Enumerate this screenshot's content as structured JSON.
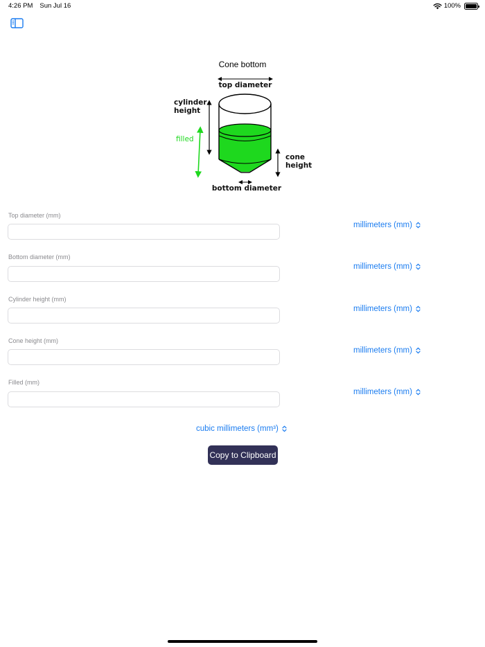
{
  "status_bar": {
    "time": "4:26 PM",
    "date": "Sun Jul 16",
    "battery": "100%"
  },
  "toolbar": {
    "sidebar_icon": "sidebar-toggle-icon"
  },
  "page": {
    "title": "Cone bottom"
  },
  "diagram": {
    "top_diameter": "top diameter",
    "cylinder_height_1": "cylinder",
    "cylinder_height_2": "height",
    "filled": "filled",
    "cone_height_1": "cone",
    "cone_height_2": "height",
    "bottom_diameter": "bottom diameter",
    "fill_color": "#1ed81e"
  },
  "fields": [
    {
      "label": "Top diameter (mm)",
      "value": "",
      "placeholder": "",
      "unit": "millimeters (mm)"
    },
    {
      "label": "Bottom diameter (mm)",
      "value": "",
      "placeholder": "",
      "unit": "millimeters (mm)"
    },
    {
      "label": "Cylinder height (mm)",
      "value": "",
      "placeholder": "",
      "unit": "millimeters (mm)"
    },
    {
      "label": "Cone height (mm)",
      "value": "",
      "placeholder": "",
      "unit": "millimeters (mm)"
    },
    {
      "label": "Filled (mm)",
      "value": "",
      "placeholder": "",
      "unit": "millimeters (mm)"
    }
  ],
  "result": {
    "unit": "cubic millimeters (mm³)"
  },
  "actions": {
    "copy_label": "Copy to Clipboard"
  },
  "colors": {
    "accent": "#1a7cf0",
    "button_bg": "#323157",
    "fill_green": "#1ed81e"
  }
}
